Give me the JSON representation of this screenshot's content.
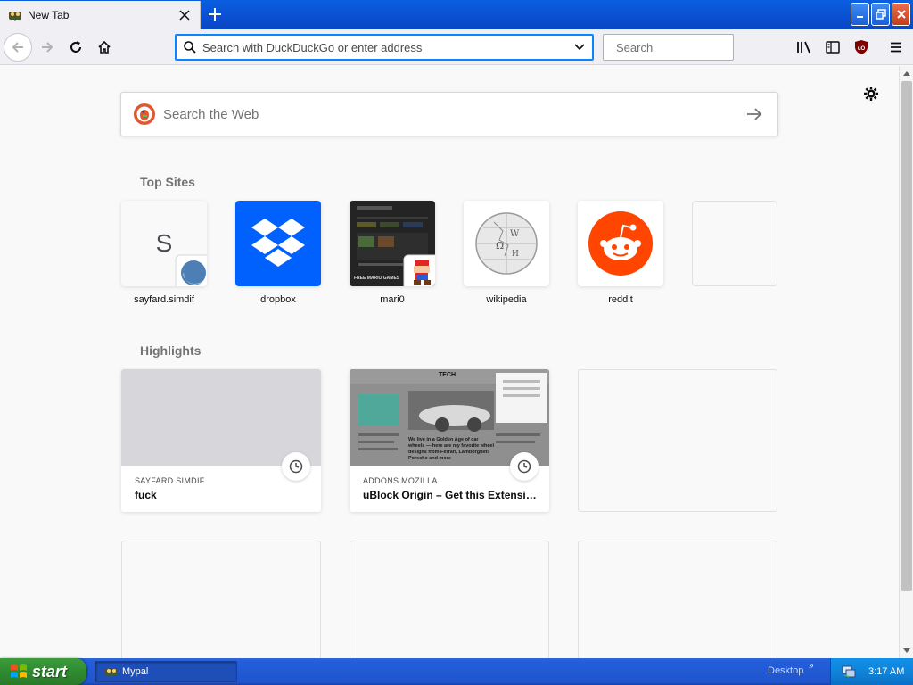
{
  "window": {
    "tab_title": "New Tab",
    "min_label": "minimize",
    "max_label": "restore",
    "close_label": "close"
  },
  "navbar": {
    "url_placeholder": "Search with DuckDuckGo or enter address",
    "search_placeholder": "Search"
  },
  "newtab": {
    "websearch_placeholder": "Search the Web",
    "topsites_title": "Top Sites",
    "highlights_title": "Highlights",
    "top_sites": [
      {
        "label": "sayfard.simdif",
        "letter": "S"
      },
      {
        "label": "dropbox"
      },
      {
        "label": "mari0"
      },
      {
        "label": "wikipedia"
      },
      {
        "label": "reddit"
      }
    ],
    "highlights": [
      {
        "host": "SAYFARD.SIMDIF",
        "title": "fuck"
      },
      {
        "host": "ADDONS.MOZILLA",
        "title": "uBlock Origin – Get this Extensio..."
      }
    ],
    "thumb_text": {
      "mario_caption": "FREE MARIO GAMES",
      "tech_label": "TECH",
      "article_headline": "We live in a Golden Age of car wheels — here are my favorite wheel designs from Ferrari, Lamborghini, Porsche and more"
    }
  },
  "taskbar": {
    "start_label": "start",
    "task_label": "Mypal",
    "desktop_label": "Desktop",
    "chevron": "»",
    "clock": "3:17 AM"
  },
  "colors": {
    "titlebar": "#0a4fd0",
    "accent_blue": "#0a84ff",
    "dropbox_blue": "#0061fe",
    "reddit_orange": "#ff4500",
    "taskbar_blue": "#245edb",
    "start_green": "#2f8a2f"
  }
}
